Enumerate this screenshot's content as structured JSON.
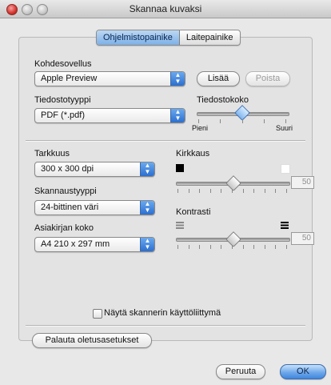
{
  "window": {
    "title": "Skannaa kuvaksi"
  },
  "tabs": [
    {
      "label": "Ohjelmistopainike",
      "active": true
    },
    {
      "label": "Laitepainike",
      "active": false
    }
  ],
  "target_app": {
    "label": "Kohdesovellus",
    "value": "Apple Preview",
    "add_label": "Lisää",
    "remove_label": "Poista"
  },
  "file_type": {
    "label": "Tiedostotyyppi",
    "value": "PDF (*.pdf)"
  },
  "file_size": {
    "label": "Tiedostokoko",
    "min_label": "Pieni",
    "max_label": "Suuri"
  },
  "resolution": {
    "label": "Tarkkuus",
    "value": "300 x 300 dpi"
  },
  "scan_type": {
    "label": "Skannaustyyppi",
    "value": "24-bittinen väri"
  },
  "doc_size": {
    "label": "Asiakirjan koko",
    "value": "A4  210 x 297 mm"
  },
  "brightness": {
    "label": "Kirkkaus",
    "value": "50"
  },
  "contrast": {
    "label": "Kontrasti",
    "value": "50"
  },
  "show_scanner_ui": {
    "label": "Näytä skannerin käyttöliittymä",
    "checked": false
  },
  "buttons": {
    "restore_defaults": "Palauta oletusasetukset",
    "cancel": "Peruuta",
    "ok": "OK"
  },
  "colors": {
    "accent": "#3f86df",
    "close": "#d3332c"
  }
}
